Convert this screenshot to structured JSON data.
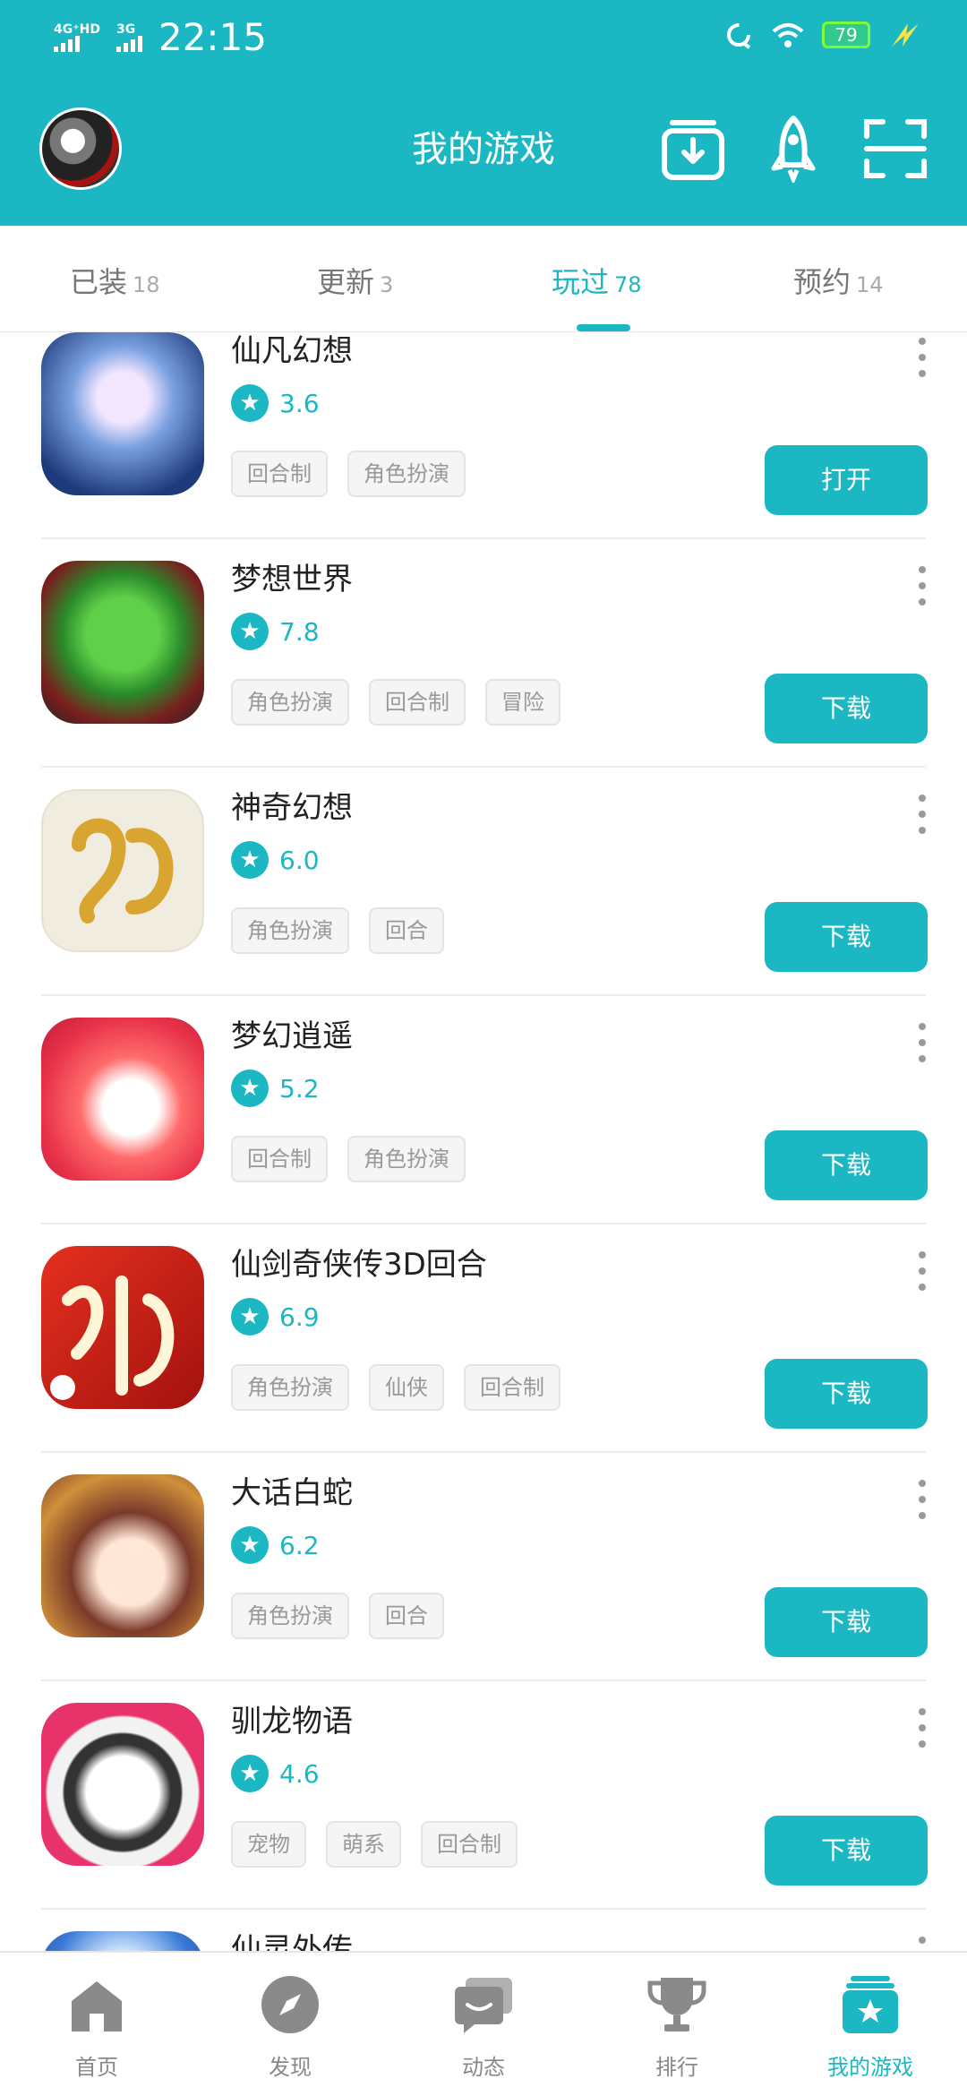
{
  "status_bar": {
    "network": "4G⁺HD",
    "network2": "3G",
    "time": "22:15",
    "battery": "79"
  },
  "header": {
    "title": "我的游戏"
  },
  "tabs": [
    {
      "label": "已装",
      "count": "18"
    },
    {
      "label": "更新",
      "count": "3"
    },
    {
      "label": "玩过",
      "count": "78",
      "active": true
    },
    {
      "label": "预约",
      "count": "14"
    }
  ],
  "games": [
    {
      "name": "仙凡幻想",
      "score": "3.6",
      "tags": [
        "回合制",
        "角色扮演"
      ],
      "button": "打开"
    },
    {
      "name": "梦想世界",
      "score": "7.8",
      "tags": [
        "角色扮演",
        "回合制",
        "冒险"
      ],
      "button": "下载"
    },
    {
      "name": "神奇幻想",
      "score": "6.0",
      "tags": [
        "角色扮演",
        "回合"
      ],
      "button": "下载"
    },
    {
      "name": "梦幻逍遥",
      "score": "5.2",
      "tags": [
        "回合制",
        "角色扮演"
      ],
      "button": "下载"
    },
    {
      "name": "仙剑奇侠传3D回合",
      "score": "6.9",
      "tags": [
        "角色扮演",
        "仙侠",
        "回合制"
      ],
      "button": "下载"
    },
    {
      "name": "大话白蛇",
      "score": "6.2",
      "tags": [
        "角色扮演",
        "回合"
      ],
      "button": "下载"
    },
    {
      "name": "驯龙物语",
      "score": "4.6",
      "tags": [
        "宠物",
        "萌系",
        "回合制"
      ],
      "button": "下载"
    },
    {
      "name": "仙灵外传",
      "score": "",
      "tags": [],
      "button": ""
    }
  ],
  "bottom_nav": [
    {
      "label": "首页",
      "icon": "home-icon"
    },
    {
      "label": "发现",
      "icon": "compass-icon"
    },
    {
      "label": "动态",
      "icon": "chat-icon"
    },
    {
      "label": "排行",
      "icon": "trophy-icon"
    },
    {
      "label": "我的游戏",
      "icon": "my-games-icon",
      "active": true
    }
  ],
  "colors": {
    "accent": "#1bb7c2",
    "tag_bg": "#f5f5f5",
    "text": "#222222"
  }
}
